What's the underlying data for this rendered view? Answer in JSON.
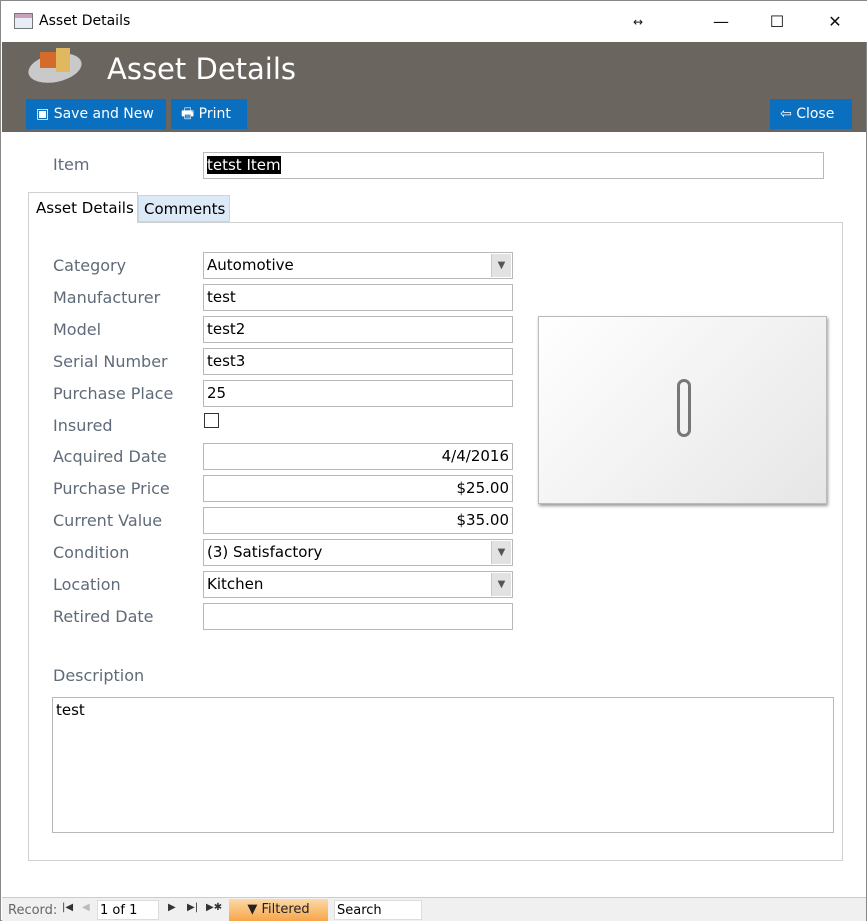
{
  "window": {
    "title": "Asset Details"
  },
  "header": {
    "title": "Asset Details",
    "save_new": "Save and New",
    "print": "Print",
    "close": "Close"
  },
  "item": {
    "label": "Item",
    "value": "tetst Item"
  },
  "tabs": [
    {
      "label": "Asset Details",
      "selected": true
    },
    {
      "label": "Comments",
      "selected": false
    }
  ],
  "fields": {
    "category": {
      "label": "Category",
      "value": "Automotive"
    },
    "manufacturer": {
      "label": "Manufacturer",
      "value": "test"
    },
    "model": {
      "label": "Model",
      "value": "test2"
    },
    "serial": {
      "label": "Serial Number",
      "value": "test3"
    },
    "place": {
      "label": "Purchase Place",
      "value": "25"
    },
    "insured": {
      "label": "Insured",
      "checked": false
    },
    "acquired": {
      "label": "Acquired Date",
      "value": "4/4/2016"
    },
    "price": {
      "label": "Purchase Price",
      "value": "$25.00"
    },
    "current": {
      "label": "Current Value",
      "value": "$35.00"
    },
    "condition": {
      "label": "Condition",
      "value": "(3) Satisfactory"
    },
    "location": {
      "label": "Location",
      "value": "Kitchen"
    },
    "retired": {
      "label": "Retired Date",
      "value": ""
    }
  },
  "description": {
    "label": "Description",
    "value": "test"
  },
  "statusbar": {
    "record_label": "Record:",
    "position": "1 of 1",
    "filter": "Filtered",
    "search_placeholder": "Search"
  }
}
